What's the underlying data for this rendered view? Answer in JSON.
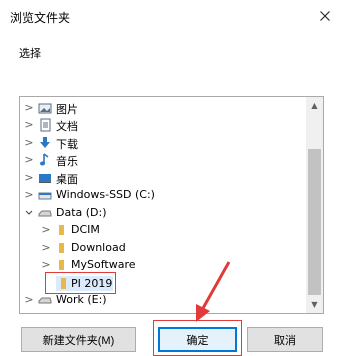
{
  "window": {
    "title": "浏览文件夹",
    "close_icon": "close-icon"
  },
  "description": "选择",
  "tree": [
    {
      "label": "图片",
      "icon": "pictures-icon",
      "expander": ">",
      "color": "#5b6d82"
    },
    {
      "label": "文档",
      "icon": "documents-icon",
      "expander": ">",
      "color": "#5b6d82"
    },
    {
      "label": "下载",
      "icon": "downloads-icon",
      "expander": ">",
      "color": "#2b78c5"
    },
    {
      "label": "音乐",
      "icon": "music-icon",
      "expander": ">",
      "color": "#2b78c5"
    },
    {
      "label": "桌面",
      "icon": "desktop-icon",
      "expander": ">",
      "color": "#2b78c5"
    },
    {
      "label": "Windows-SSD (C:)",
      "icon": "drive-icon",
      "expander": ">",
      "color": "#2b78c5"
    },
    {
      "label": "Data (D:)",
      "icon": "drive-icon",
      "expander": "v",
      "color": "#888888"
    },
    {
      "label": "DCIM",
      "icon": "folder-icon",
      "expander": ">",
      "color": "#e8b84a"
    },
    {
      "label": "Download",
      "icon": "folder-icon",
      "expander": ">",
      "color": "#e8b84a"
    },
    {
      "label": "MySoftware",
      "icon": "folder-icon",
      "expander": ">",
      "color": "#e8b84a"
    },
    {
      "label": "PI 2019",
      "icon": "folder-icon",
      "expander": "",
      "color": "#e8b84a",
      "selected": true
    },
    {
      "label": "Work (E:)",
      "icon": "drive-icon",
      "expander": ">",
      "color": "#888888"
    }
  ],
  "buttons": {
    "new_folder": "新建文件夹(M)",
    "ok": "确定",
    "cancel": "取消"
  },
  "colors": {
    "highlight": "#e03a3a",
    "selection": "#dcebfc",
    "focus": "#0078d7"
  }
}
